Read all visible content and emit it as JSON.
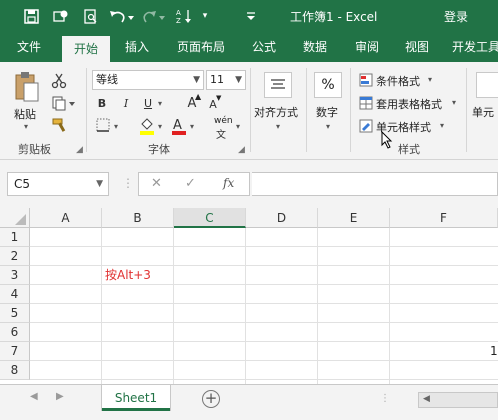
{
  "app": {
    "title": "工作簿1 - Excel",
    "login": "登录",
    "qat": {
      "save_icon": "save-icon",
      "touch_icon": "touch-mode-icon",
      "preview_icon": "print-preview-icon",
      "undo_icon": "undo-icon",
      "redo_icon": "redo-icon",
      "sort_icon": "sort-icon",
      "customize_icon": "customize-qat-icon"
    }
  },
  "tabs": [
    "文件",
    "开始",
    "插入",
    "页面布局",
    "公式",
    "数据",
    "审阅",
    "视图",
    "开发工具"
  ],
  "active_tab": "开始",
  "ribbon": {
    "clipboard": {
      "paste": "粘贴",
      "label": "剪贴板"
    },
    "font": {
      "name": "等线",
      "size": "11",
      "bold": "B",
      "italic": "I",
      "underline": "U",
      "grow": "A",
      "shrink": "A",
      "phonetic": "wén",
      "label": "字体"
    },
    "alignment": {
      "label": "对齐方式"
    },
    "number": {
      "icon_text": "%",
      "label": "数字"
    },
    "styles": {
      "conditional": "条件格式",
      "table": "套用表格格式",
      "cell": "单元格样式",
      "label": "样式"
    },
    "cells": {
      "label": "单元"
    }
  },
  "formula_bar": {
    "name_box": "C5",
    "cancel": "✕",
    "enter": "✓",
    "fx": "fx",
    "formula": ""
  },
  "grid": {
    "columns": [
      "A",
      "B",
      "C",
      "D",
      "E",
      "F"
    ],
    "rows": [
      "1",
      "2",
      "3",
      "4",
      "5",
      "6",
      "7",
      "8"
    ],
    "cells": {
      "B3": "按Alt+3",
      "G7": "1"
    },
    "text_color_b3": "#e03131"
  },
  "sheets": {
    "tabs": [
      "Sheet1"
    ],
    "add": "+"
  },
  "colors": {
    "brand": "#217346",
    "ribbon_bg": "#f3f3f3"
  }
}
